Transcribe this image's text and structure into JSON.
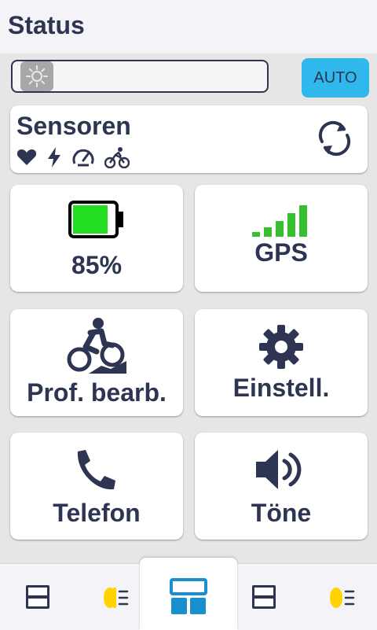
{
  "header": {
    "title": "Status"
  },
  "brightness": {
    "level_percent": 0,
    "auto_label": "AUTO"
  },
  "sensors": {
    "label": "Sensoren",
    "icons": [
      "heart-icon",
      "bolt-icon",
      "speedometer-icon",
      "cyclist-icon"
    ],
    "refresh_icon": "refresh-icon"
  },
  "tiles": [
    {
      "name": "battery",
      "label": "85%",
      "icon": "battery-icon",
      "level_percent": 85,
      "color": "#22dd22"
    },
    {
      "name": "gps",
      "label": "GPS",
      "icon": "signal-bars-icon",
      "bars": 5,
      "color": "#35c02e"
    },
    {
      "name": "profile",
      "label": "Prof. bearb.",
      "icon": "mountain-bike-icon"
    },
    {
      "name": "settings",
      "label": "Einstell.",
      "icon": "gear-icon"
    },
    {
      "name": "phone",
      "label": "Telefon",
      "icon": "phone-icon"
    },
    {
      "name": "sounds",
      "label": "Töne",
      "icon": "speaker-icon"
    }
  ],
  "bottom_nav": [
    {
      "icon": "data-fields-icon"
    },
    {
      "icon": "headlight-icon"
    },
    {
      "icon": "widgets-icon",
      "active": true
    },
    {
      "icon": "data-fields-icon"
    },
    {
      "icon": "headlight-icon"
    }
  ],
  "colors": {
    "primary": "#2e3552",
    "accent": "#2fb8ec",
    "battery": "#22dd22",
    "gps": "#35c02e",
    "headlight": "#ffd400"
  }
}
